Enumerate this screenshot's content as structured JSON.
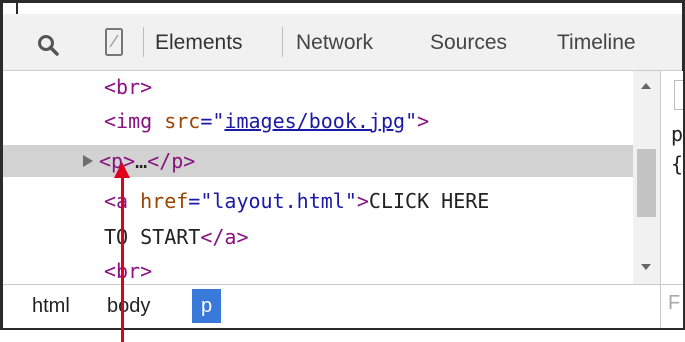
{
  "toolbar": {
    "icons": {
      "search": "search-icon",
      "device": "device-mode-icon"
    },
    "tabs": [
      {
        "label": "Elements",
        "active": true
      },
      {
        "label": "Network",
        "active": false
      },
      {
        "label": "Sources",
        "active": false
      },
      {
        "label": "Timeline",
        "active": false
      }
    ]
  },
  "tree": {
    "lines": [
      {
        "tag_open": "<br>"
      },
      {
        "tag_open": "<img ",
        "attr": "src",
        "eq": "=\"",
        "link": "images/book.jpg",
        "close_quote": "\"",
        "tag_end": ">"
      },
      {
        "tag_open": "<p>",
        "ellipsis": "…",
        "tag_close": "</p>",
        "selected": true
      },
      {
        "tag_open": "<a ",
        "attr": "href",
        "value": "=\"layout.html\"",
        "tag_end": ">",
        "text": "CLICK HERE"
      },
      {
        "text": "TO START",
        "tag_close": "</a>"
      },
      {
        "tag_open": "<br>"
      }
    ]
  },
  "styles_pane": {
    "line1": "p",
    "line2": "{"
  },
  "breadcrumb": {
    "items": [
      {
        "label": "html",
        "active": false
      },
      {
        "label": "body",
        "active": false
      },
      {
        "label": "p",
        "active": true
      }
    ],
    "filter_placeholder": "F"
  },
  "colors": {
    "tag": "#881280",
    "attribute_name": "#994500",
    "attribute_value": "#1a1aa6",
    "selection": "#d2d2d2",
    "breadcrumb_active": "#3879d9",
    "annotation_arrow": "#e0001b"
  }
}
